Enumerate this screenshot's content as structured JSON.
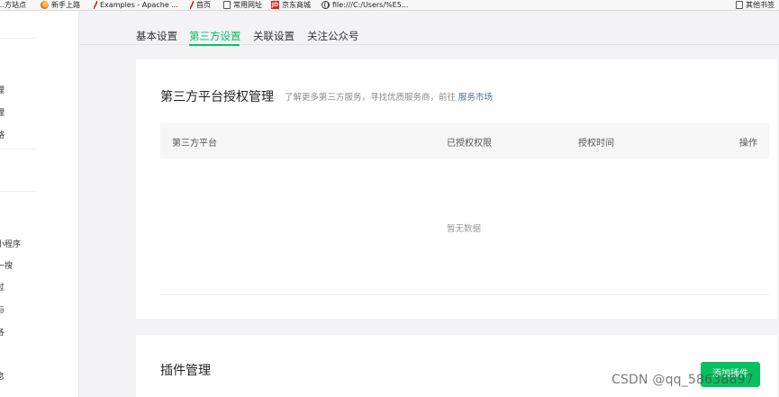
{
  "bookmarks": [
    {
      "label": "…方站点",
      "icon": "partial-icon"
    },
    {
      "label": "新手上路",
      "icon": "firefox-icon"
    },
    {
      "label": "Examples - Apache ...",
      "icon": "apache-feather-icon"
    },
    {
      "label": "首页",
      "icon": "apache-feather-icon"
    },
    {
      "label": "常用网址",
      "icon": "page-icon"
    },
    {
      "label": "京东商城",
      "icon": "jd-icon"
    },
    {
      "label": "file:///C:/Users/%E5...",
      "icon": "globe-icon"
    },
    {
      "label": "其他书签",
      "icon": "page-icon"
    }
  ],
  "sidebar": {
    "items": [
      "理",
      "理",
      "略",
      "小程序",
      "一搜",
      "过",
      "与",
      "各",
      "息"
    ]
  },
  "tabs": [
    {
      "label": "基本设置",
      "active": false
    },
    {
      "label": "第三方设置",
      "active": true
    },
    {
      "label": "关联设置",
      "active": false
    },
    {
      "label": "关注公众号",
      "active": false
    }
  ],
  "auth_section": {
    "title": "第三方平台授权管理",
    "subtitle": "了解更多第三方服务，寻找优质服务商，前往",
    "link": "服务市场",
    "columns": [
      "第三方平台",
      "已授权权限",
      "授权时间",
      "操作"
    ],
    "empty_text": "暂无数据"
  },
  "plugin_section": {
    "title": "插件管理",
    "add_button": "添加插件"
  },
  "watermark": "CSDN @qq_58638897",
  "colors": {
    "accent": "#07c160",
    "link": "#576b95",
    "background": "#f3f3f5"
  }
}
